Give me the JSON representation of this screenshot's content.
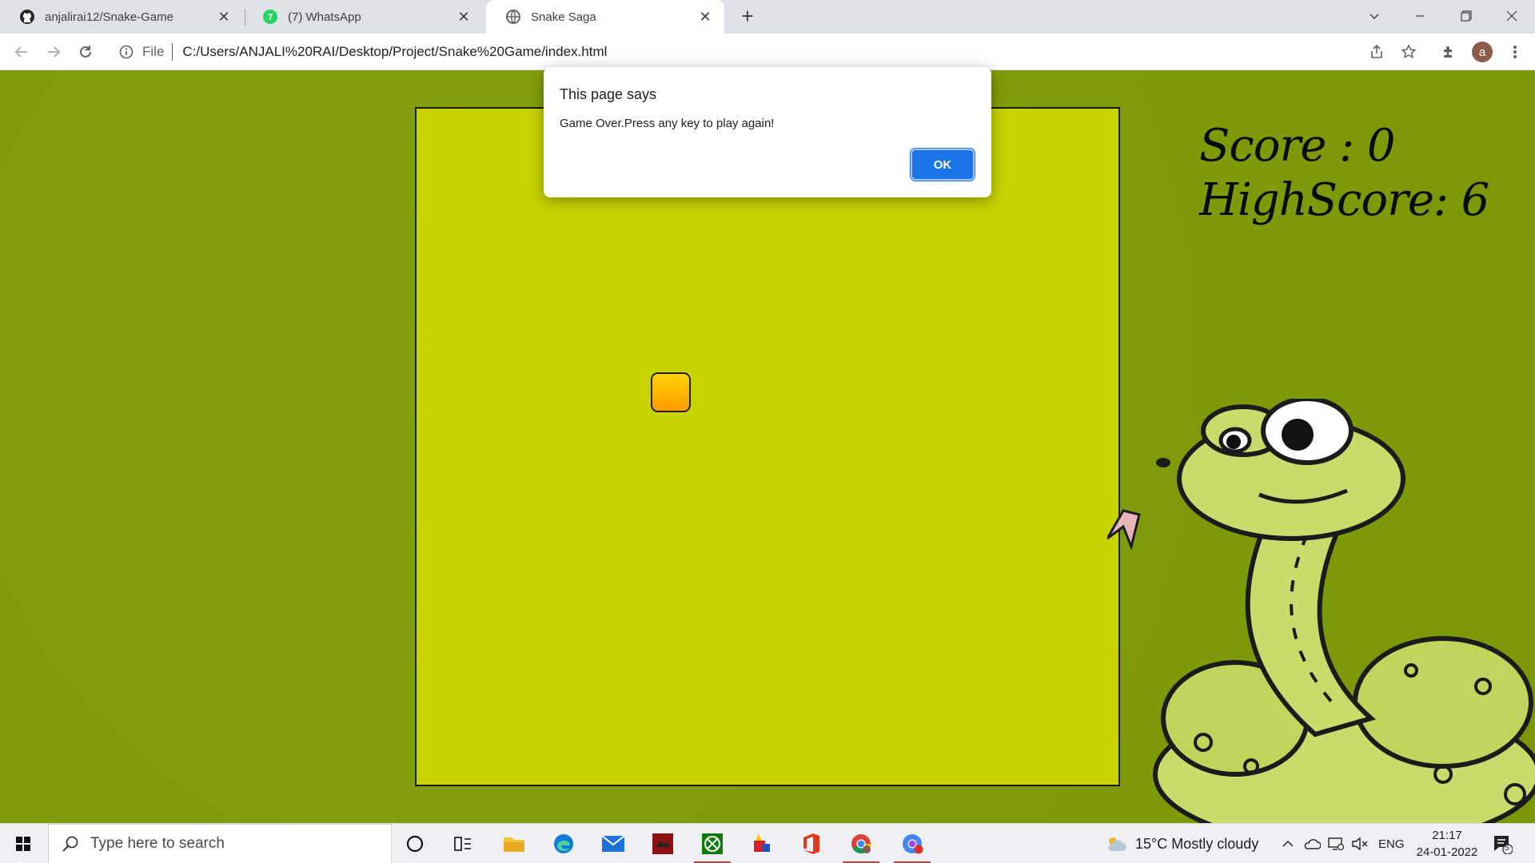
{
  "browser": {
    "tabs": [
      {
        "title": "anjalirai12/Snake-Game",
        "icon": "github-icon",
        "active": false
      },
      {
        "title": "(7) WhatsApp",
        "icon": "whatsapp-icon",
        "active": false
      },
      {
        "title": "Snake Saga",
        "icon": "globe-icon",
        "active": true
      }
    ],
    "address": {
      "scheme_label": "File",
      "url": "C:/Users/ANJALI%20RAI/Desktop/Project/Snake%20Game/index.html"
    },
    "profile_initial": "a"
  },
  "game": {
    "score_text": "Score : 0",
    "highscore_text": "HighScore: 6",
    "colors": {
      "background": "#7f9d06",
      "board": "#c8d300",
      "food": "#ffc400",
      "snake": "#c9db6a"
    }
  },
  "dialog": {
    "title": "This page says",
    "message": "Game Over.Press any key to play again!",
    "ok_label": "OK"
  },
  "taskbar": {
    "search_placeholder": "Type here to search",
    "weather": "15°C  Mostly cloudy",
    "language": "ENG",
    "time": "21:17",
    "date": "24-01-2022",
    "notification_count": "5",
    "pinned": [
      "cortana-icon",
      "task-view-icon",
      "file-explorer-icon",
      "edge-icon",
      "mail-icon",
      "app-red-icon",
      "xbox-icon",
      "paint-icon",
      "office-icon",
      "chrome-icon",
      "chrome-profile-icon"
    ]
  }
}
